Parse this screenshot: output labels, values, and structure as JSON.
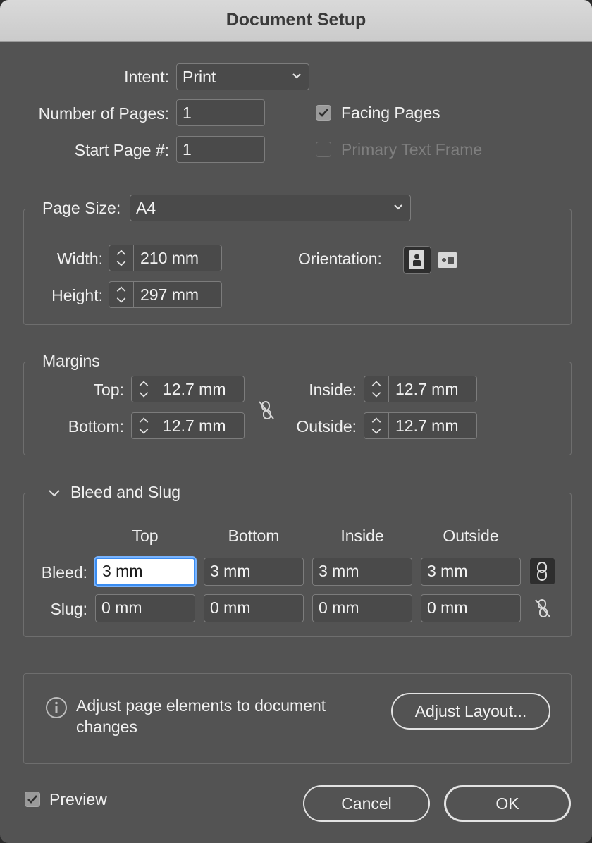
{
  "window": {
    "title": "Document Setup"
  },
  "intent": {
    "label": "Intent:",
    "value": "Print"
  },
  "pages": {
    "label": "Number of Pages:",
    "value": "1"
  },
  "start_page": {
    "label": "Start Page #:",
    "value": "1"
  },
  "facing_pages": {
    "label": "Facing Pages",
    "checked": true
  },
  "primary_text_frame": {
    "label": "Primary Text Frame",
    "checked": false,
    "enabled": false
  },
  "page_size": {
    "label": "Page Size:",
    "value": "A4",
    "width_label": "Width:",
    "width": "210 mm",
    "height_label": "Height:",
    "height": "297 mm",
    "orientation_label": "Orientation:",
    "orientation": "portrait"
  },
  "margins": {
    "title": "Margins",
    "top_label": "Top:",
    "top": "12.7 mm",
    "bottom_label": "Bottom:",
    "bottom": "12.7 mm",
    "inside_label": "Inside:",
    "inside": "12.7 mm",
    "outside_label": "Outside:",
    "outside": "12.7 mm",
    "linked": false
  },
  "bleed_slug": {
    "title": "Bleed and Slug",
    "columns": [
      "Top",
      "Bottom",
      "Inside",
      "Outside"
    ],
    "bleed_label": "Bleed:",
    "bleed": [
      "3 mm",
      "3 mm",
      "3 mm",
      "3 mm"
    ],
    "slug_label": "Slug:",
    "slug": [
      "0 mm",
      "0 mm",
      "0 mm",
      "0 mm"
    ],
    "bleed_linked": true,
    "slug_linked": false
  },
  "adjust": {
    "message": "Adjust page elements to document changes",
    "line1": "Adjust page elements to document",
    "line2": "changes",
    "button": "Adjust Layout..."
  },
  "preview": {
    "label": "Preview",
    "checked": true
  },
  "buttons": {
    "cancel": "Cancel",
    "ok": "OK"
  },
  "colors": {
    "dialog_bg": "#535353",
    "titlebar": "#d0d0d0",
    "focus": "#3a8cf0"
  }
}
